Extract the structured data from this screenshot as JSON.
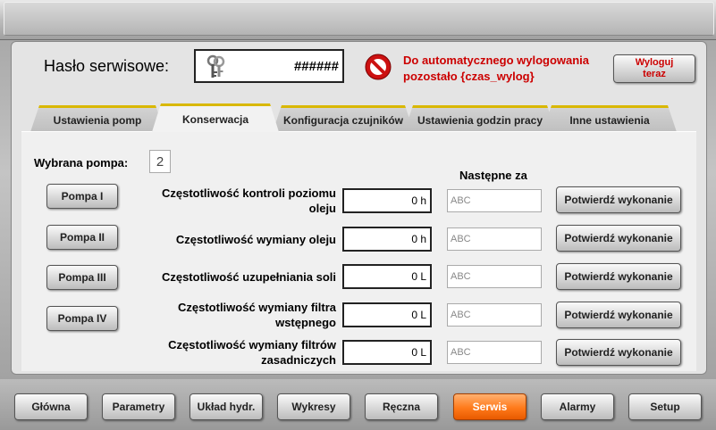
{
  "header": {
    "password_label": "Hasło serwisowe:",
    "password_value": "######",
    "logout_message_line1": "Do automatycznego wylogowania",
    "logout_message_line2": "pozostało {czas_wylog}",
    "logout_button_line1": "Wyloguj",
    "logout_button_line2": "teraz"
  },
  "tabs": [
    {
      "label": "Ustawienia pomp",
      "active": false
    },
    {
      "label": "Konserwacja",
      "active": true
    },
    {
      "label": "Konfiguracja czujników",
      "active": false
    },
    {
      "label": "Ustawienia godzin pracy",
      "active": false
    },
    {
      "label": "Inne ustawienia",
      "active": false
    }
  ],
  "selected_pump": {
    "label": "Wybrana pompa:",
    "value": "2"
  },
  "next_header": "Następne za",
  "pumps": [
    "Pompa I",
    "Pompa II",
    "Pompa III",
    "Pompa IV"
  ],
  "rows": [
    {
      "label_line1": "Częstotliwość kontroli poziomu",
      "label_line2": "oleju",
      "value": "0 h",
      "next": "ABC",
      "button": "Potwierdź wykonanie"
    },
    {
      "label_line1": "Częstotliwość wymiany oleju",
      "label_line2": "",
      "value": "0 h",
      "next": "ABC",
      "button": "Potwierdź wykonanie"
    },
    {
      "label_line1": "Częstotliwość uzupełniania soli",
      "label_line2": "",
      "value": "0 L",
      "next": "ABC",
      "button": "Potwierdź wykonanie"
    },
    {
      "label_line1": "Częstotliwość wymiany filtra",
      "label_line2": "wstępnego",
      "value": "0 L",
      "next": "ABC",
      "button": "Potwierdź wykonanie"
    },
    {
      "label_line1": "Częstotliwość wymiany filtrów",
      "label_line2": "zasadniczych",
      "value": "0 L",
      "next": "ABC",
      "button": "Potwierdź wykonanie"
    }
  ],
  "nav": [
    {
      "label": "Główna",
      "active": false
    },
    {
      "label": "Parametry",
      "active": false
    },
    {
      "label": "Układ hydr.",
      "active": false
    },
    {
      "label": "Wykresy",
      "active": false
    },
    {
      "label": "Ręczna",
      "active": false
    },
    {
      "label": "Serwis",
      "active": true
    },
    {
      "label": "Alarmy",
      "active": false
    },
    {
      "label": "Setup",
      "active": false
    }
  ],
  "colors": {
    "accent_orange": "#ff7a1a",
    "warning_red": "#cc0000",
    "tab_gold": "#d9b800"
  }
}
